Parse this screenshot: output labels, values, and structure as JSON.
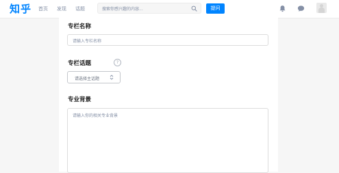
{
  "header": {
    "logo": "知乎",
    "nav": [
      "首页",
      "发现",
      "话题"
    ],
    "search_placeholder": "搜索你感兴趣的内容...",
    "ask_label": "提问"
  },
  "form": {
    "name_label": "专栏名称",
    "name_placeholder": "请输入专栏名称",
    "topic_label": "专栏话题",
    "help_glyph": "?",
    "topic_select": "请选择主话题",
    "background_label": "专业背景",
    "background_placeholder": "请输入你的相关专业背景"
  },
  "colors": {
    "brand": "#0084ff",
    "page_bg": "#f6f6f6"
  }
}
